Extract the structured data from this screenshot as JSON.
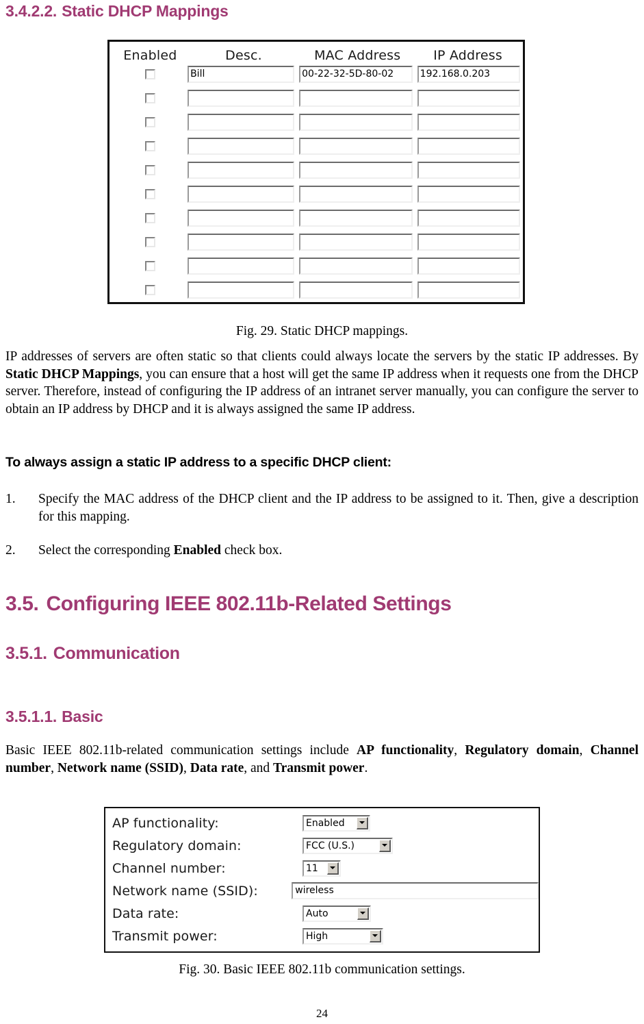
{
  "headings": {
    "sec_3422_num": "3.4.2.2.",
    "sec_3422_title": "Static DHCP Mappings",
    "sec_35_num": "3.5.",
    "sec_35_title": "Configuring IEEE 802.11b-Related Settings",
    "sec_351_num": "3.5.1.",
    "sec_351_title": "Communication",
    "sec_3511_num": "3.5.1.1.",
    "sec_3511_title": "Basic",
    "procedure_heading": "To always assign a static IP address to a specific DHCP client:"
  },
  "figure_dhcp": {
    "columns": [
      "Enabled",
      "Desc.",
      "MAC Address",
      "IP Address"
    ],
    "rows": [
      {
        "enabled": false,
        "desc": "Bill",
        "mac": "00-22-32-5D-80-02",
        "ip": "192.168.0.203"
      },
      {
        "enabled": false,
        "desc": "",
        "mac": "",
        "ip": ""
      },
      {
        "enabled": false,
        "desc": "",
        "mac": "",
        "ip": ""
      },
      {
        "enabled": false,
        "desc": "",
        "mac": "",
        "ip": ""
      },
      {
        "enabled": false,
        "desc": "",
        "mac": "",
        "ip": ""
      },
      {
        "enabled": false,
        "desc": "",
        "mac": "",
        "ip": ""
      },
      {
        "enabled": false,
        "desc": "",
        "mac": "",
        "ip": ""
      },
      {
        "enabled": false,
        "desc": "",
        "mac": "",
        "ip": ""
      },
      {
        "enabled": false,
        "desc": "",
        "mac": "",
        "ip": ""
      },
      {
        "enabled": false,
        "desc": "",
        "mac": "",
        "ip": ""
      }
    ],
    "caption": "Fig. 29. Static DHCP mappings."
  },
  "body": {
    "intro_p1_a": "IP addresses of servers are often static so that clients could always locate the servers by the static IP addresses. By ",
    "intro_p1_b": "Static DHCP Mappings",
    "intro_p1_c": ", you can ensure that a host will get the same IP address when it requests one from the DHCP server. Therefore, instead of configuring the IP address of an intranet server manually, you can configure the server to obtain an IP address by DHCP and it is always assigned the same IP address.",
    "step1_marker": "1.",
    "step1_text": "Specify the MAC address of the DHCP client and the IP address to be assigned to it. Then, give a description for this mapping.",
    "step2_marker": "2.",
    "step2_a": "Select the corresponding ",
    "step2_b": "Enabled",
    "step2_c": " check box.",
    "basic_p_a": "Basic IEEE 802.11b-related communication settings include ",
    "basic_p_b1": "AP functionality",
    "basic_p_sep1": ", ",
    "basic_p_b2": "Regulatory domain",
    "basic_p_sep2": ", ",
    "basic_p_b3": "Channel number",
    "basic_p_sep3": ", ",
    "basic_p_b4": "Network name (SSID)",
    "basic_p_sep4": ", ",
    "basic_p_b5": "Data rate",
    "basic_p_sep5": ", and ",
    "basic_p_b6": "Transmit power",
    "basic_p_end": "."
  },
  "figure_basic": {
    "fields": [
      {
        "label": "AP functionality:",
        "value": "Enabled",
        "control": "select"
      },
      {
        "label": "Regulatory domain:",
        "value": "FCC (U.S.)",
        "control": "select"
      },
      {
        "label": "Channel number:",
        "value": "11",
        "control": "select"
      },
      {
        "label": "Network name (SSID):",
        "value": "wireless",
        "control": "text"
      },
      {
        "label": "Data rate:",
        "value": "Auto",
        "control": "select"
      },
      {
        "label": "Transmit power:",
        "value": "High",
        "control": "select"
      }
    ],
    "caption": "Fig. 30. Basic IEEE 802.11b communication settings."
  },
  "footer": {
    "page_number": "24"
  },
  "colors": {
    "heading": "#a03a72",
    "text": "#000000",
    "page_bg": "#ffffff"
  }
}
